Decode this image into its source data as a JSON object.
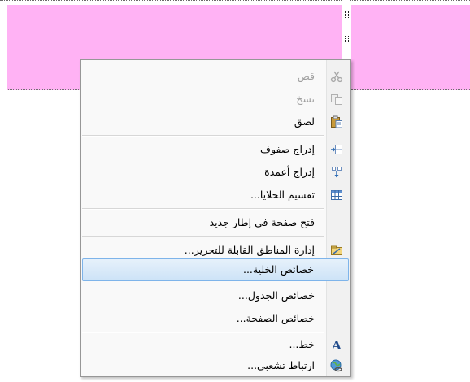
{
  "context_menu": {
    "items": [
      {
        "label": "قص",
        "enabled": false,
        "icon": "scissors-icon"
      },
      {
        "label": "نسخ",
        "enabled": false,
        "icon": "copy-icon"
      },
      {
        "label": "لصق",
        "enabled": true,
        "icon": "paste-icon"
      },
      {
        "label": "إدراج صفوف",
        "enabled": true,
        "icon": "insert-rows-icon"
      },
      {
        "label": "إدراج أعمدة",
        "enabled": true,
        "icon": "insert-columns-icon"
      },
      {
        "label": "تقسيم الخلايا...",
        "enabled": true,
        "icon": "split-cells-icon"
      },
      {
        "label": "فتح صفحة في إطار جديد",
        "enabled": true,
        "icon": null
      },
      {
        "label": "إدارة المناطق القابلة للتحرير...",
        "enabled": true,
        "icon": "editable-regions-icon"
      },
      {
        "label": "خصائص الخلية...",
        "enabled": true,
        "highlighted": true,
        "icon": null
      },
      {
        "label": "خصائص الجدول...",
        "enabled": true,
        "icon": null
      },
      {
        "label": "خصائص الصفحة...",
        "enabled": true,
        "icon": null
      },
      {
        "label": "خط...",
        "enabled": true,
        "icon": "font-icon"
      },
      {
        "label": "ارتباط تشعبي...",
        "enabled": true,
        "icon": "hyperlink-icon"
      }
    ]
  },
  "colors": {
    "cell_background": "#ffb2f4",
    "menu_highlight_border": "#7eb4ea"
  }
}
